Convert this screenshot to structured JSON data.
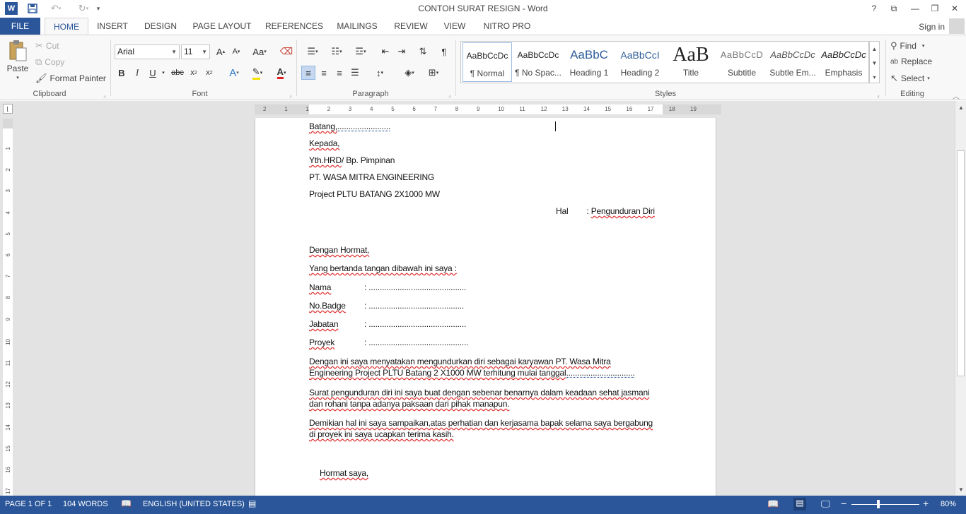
{
  "app": {
    "title": "CONTOH SURAT RESIGN - Word",
    "logo": "W",
    "signin": "Sign in"
  },
  "tabs": [
    "FILE",
    "HOME",
    "INSERT",
    "DESIGN",
    "PAGE LAYOUT",
    "REFERENCES",
    "MAILINGS",
    "REVIEW",
    "VIEW",
    "NITRO PRO"
  ],
  "ribbon": {
    "clipboard": {
      "label": "Clipboard",
      "paste": "Paste",
      "cut": "Cut",
      "copy": "Copy",
      "format_painter": "Format Painter"
    },
    "font": {
      "label": "Font",
      "font_name": "Arial",
      "font_size": "11"
    },
    "paragraph": {
      "label": "Paragraph"
    },
    "styles": {
      "label": "Styles",
      "items": [
        {
          "preview": "AaBbCcDc",
          "name": "¶ Normal"
        },
        {
          "preview": "AaBbCcDc",
          "name": "¶ No Spac..."
        },
        {
          "preview": "AaBbC",
          "name": "Heading 1"
        },
        {
          "preview": "AaBbCcI",
          "name": "Heading 2"
        },
        {
          "preview": "AaB",
          "name": "Title"
        },
        {
          "preview": "AaBbCcD",
          "name": "Subtitle"
        },
        {
          "preview": "AaBbCcDc",
          "name": "Subtle Em..."
        },
        {
          "preview": "AaBbCcDc",
          "name": "Emphasis"
        }
      ]
    },
    "editing": {
      "label": "Editing",
      "find": "Find",
      "replace": "Replace",
      "select": "Select"
    }
  },
  "ruler": {
    "h_ticks": [
      "2",
      "1",
      "1",
      "2",
      "3",
      "4",
      "5",
      "6",
      "7",
      "8",
      "9",
      "10",
      "11",
      "12",
      "13",
      "14",
      "15",
      "16",
      "17",
      "18",
      "19"
    ],
    "v_ticks": [
      "1",
      "2",
      "3",
      "4",
      "5",
      "6",
      "7",
      "8",
      "9",
      "10",
      "11",
      "12",
      "13",
      "14",
      "15",
      "16",
      "17"
    ]
  },
  "document": {
    "batang": "Batang,",
    "batang_dots": "........................",
    "kepada": "Kepada,",
    "yth": "Yth.HRD",
    "yth_rest": "/ Bp. Pimpinan",
    "company": "PT. WASA MITRA ENGINEERING",
    "project": "Project PLTU BATANG 2X1000 MW",
    "hal_label": "Hal",
    "hal_colon": ":",
    "hal_value": "Pengunduran Diri",
    "salam": "Dengan Hormat,",
    "intro": "Yang bertanda tangan dibawah ini saya :",
    "fields": [
      {
        "label": "Nama",
        "value": ": ............................................"
      },
      {
        "label": "No.Badge",
        "value": ": ..........................................."
      },
      {
        "label": "Jabatan",
        "value": ": ............................................"
      },
      {
        "label": "Proyek",
        "value": ": ............................................."
      }
    ],
    "para1_line1": "Dengan ini saya menyatakan mengundurkan diri sebagai karyawan PT. Wasa Mitra",
    "para1_line2a": "Engineering Project PLTU Batang 2 X1000 MW terhitung mulai tanggal",
    "para1_line2b": "...............................",
    "para2_line1": "Surat pengunduran diri ini saya buat dengan sebenar benarnya dalam keadaan sehat jasmani",
    "para2_line2": "dan rohani tanpa adanya paksaan dari pihak manapun.",
    "para3_line1": "Demikian hal ini saya sampaikan,atas perhatian dan kerjasama bapak selama saya bergabung",
    "para3_line2": "di proyek ini saya ucapkan terima kasih.",
    "closing": "Hormat saya,"
  },
  "status": {
    "page": "PAGE 1 OF 1",
    "words": "104 WORDS",
    "language": "ENGLISH (UNITED STATES)",
    "zoom": "80%",
    "zoom_level": 0.4
  },
  "colors": {
    "accent": "#2b579a",
    "squiggle": "#e03030"
  }
}
